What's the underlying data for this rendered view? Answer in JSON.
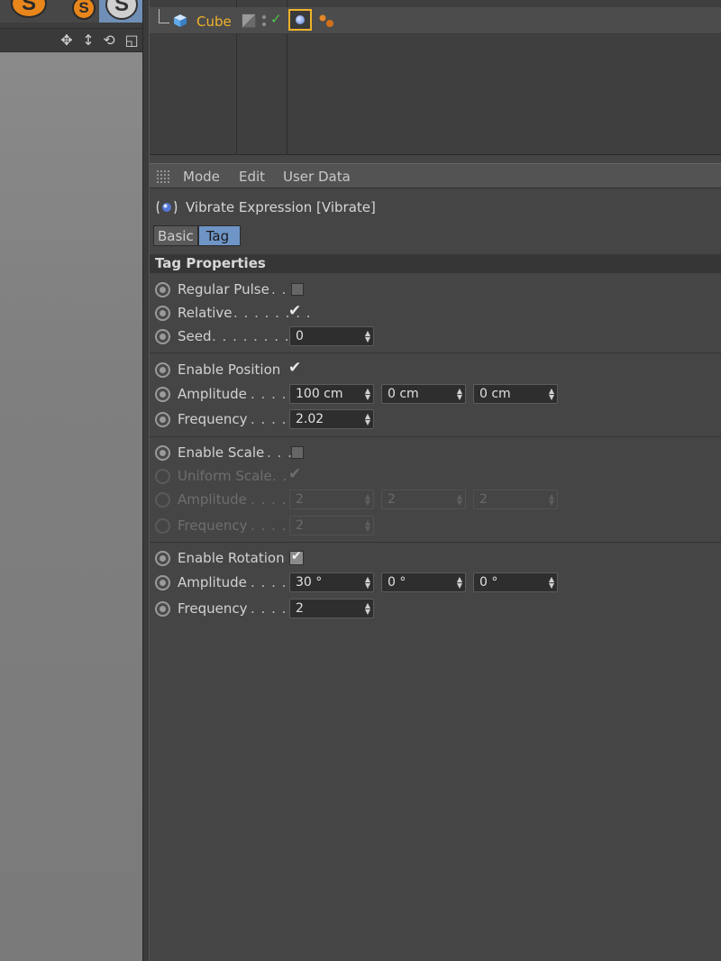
{
  "object_manager": {
    "object_name": "Cube"
  },
  "attributes": {
    "menu": [
      "Mode",
      "Edit",
      "User Data"
    ],
    "title": "Vibrate Expression [Vibrate]",
    "tabs": [
      "Basic",
      "Tag"
    ],
    "active_tab": "Tag",
    "section": "Tag Properties",
    "regular_pulse": {
      "label": "Regular Pulse",
      "dots": ". .",
      "checked": false
    },
    "relative": {
      "label": "Relative",
      "dots": ". . . . . . . .",
      "checked": true
    },
    "seed": {
      "label": "Seed",
      "dots": ". . . . . . . . . . .",
      "value": "0"
    },
    "position": {
      "enable_label": "Enable Position",
      "enabled": true,
      "amplitude_label": "Amplitude",
      "amplitude_dots": ". . . . .",
      "amplitude": [
        "100 cm",
        "0 cm",
        "0 cm"
      ],
      "frequency_label": "Frequency",
      "frequency_dots": ". . . . .",
      "frequency": "2.02"
    },
    "scale": {
      "enable_label": "Enable Scale",
      "enable_dots": ". . .",
      "enabled": false,
      "uniform_label": "Uniform Scale",
      "uniform_dots": ". .",
      "uniform": true,
      "amplitude_label": "Amplitude",
      "amplitude_dots": ". . . . .",
      "amplitude": [
        "2",
        "2",
        "2"
      ],
      "frequency_label": "Frequency",
      "frequency_dots": ". . . . .",
      "frequency": "2"
    },
    "rotation": {
      "enable_label": "Enable Rotation",
      "enabled": true,
      "amplitude_label": "Amplitude",
      "amplitude_dots": ". . . . .",
      "amplitude": [
        "30 °",
        "0 °",
        "0 °"
      ],
      "frequency_label": "Frequency",
      "frequency_dots": ". . . . .",
      "frequency": "2"
    }
  },
  "colors": {
    "accent_orange": "#f0b32a",
    "tab_active": "#6f95c7",
    "panel_bg": "#454545"
  }
}
